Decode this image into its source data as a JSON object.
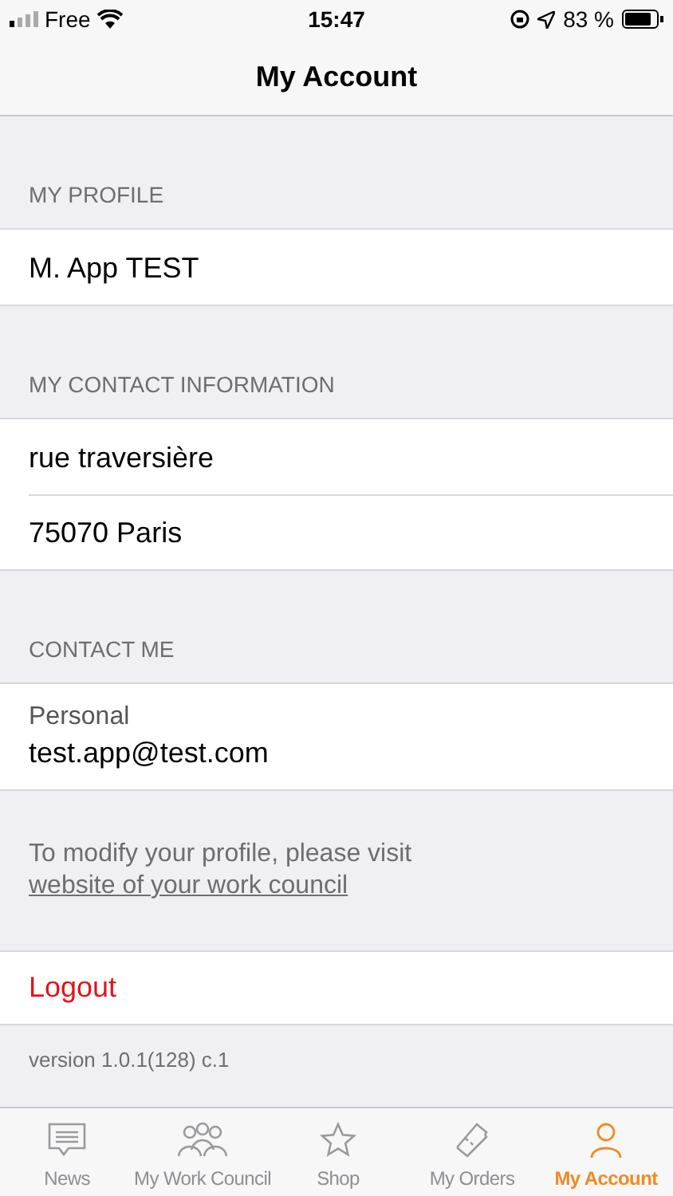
{
  "status_bar": {
    "carrier": "Free",
    "time": "15:47",
    "battery": "83 %"
  },
  "nav_bar": {
    "title": "My Account"
  },
  "sections": [
    {
      "header": "MY PROFILE",
      "rows": [
        {
          "value": "M. App TEST"
        }
      ]
    },
    {
      "header": "MY CONTACT INFORMATION",
      "rows": [
        {
          "value": "rue traversière"
        },
        {
          "value": "75070 Paris"
        }
      ]
    },
    {
      "header": "CONTACT ME",
      "rows": [
        {
          "label": "Personal",
          "value": "test.app@test.com"
        }
      ]
    }
  ],
  "note": {
    "text": "To modify your profile, please visit",
    "link": "website of your work council"
  },
  "logout": "Logout",
  "version": "version 1.0.1(128) c.1",
  "tabs": [
    {
      "label": "News",
      "kind": "news",
      "selected": false
    },
    {
      "label": "My Work Council",
      "kind": "people",
      "selected": false
    },
    {
      "label": "Shop",
      "kind": "star",
      "selected": false
    },
    {
      "label": "My Orders",
      "kind": "ticket",
      "selected": false
    },
    {
      "label": "My Account",
      "kind": "person",
      "selected": true
    }
  ]
}
